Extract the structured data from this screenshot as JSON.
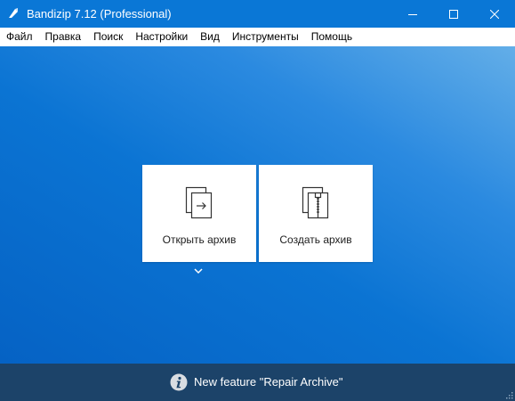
{
  "window": {
    "title": "Bandizip 7.12 (Professional)",
    "controls": [
      "minimize-icon",
      "maximize-icon",
      "close-icon"
    ]
  },
  "menu": {
    "items": [
      {
        "label": "Файл"
      },
      {
        "label": "Правка"
      },
      {
        "label": "Поиск"
      },
      {
        "label": "Настройки"
      },
      {
        "label": "Вид"
      },
      {
        "label": "Инструменты"
      },
      {
        "label": "Помощь"
      }
    ]
  },
  "main": {
    "tiles": [
      {
        "label": "Открыть архив",
        "icon": "open-archive-icon"
      },
      {
        "label": "Создать архив",
        "icon": "create-archive-icon"
      }
    ],
    "more_icon": "chevron-down-icon"
  },
  "status": {
    "icon": "info-icon",
    "text": "New feature \"Repair Archive\""
  },
  "colors": {
    "titlebar": "#0a77d6",
    "background": "#0b78d7",
    "statusbar": "#1c4369",
    "tile": "#ffffff"
  }
}
